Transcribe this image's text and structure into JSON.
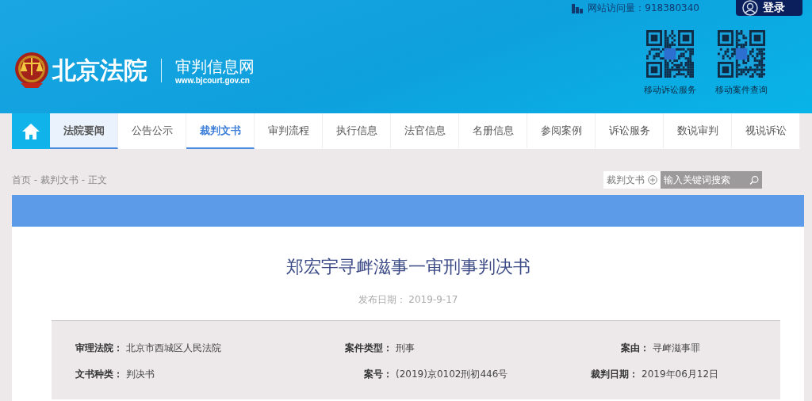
{
  "header": {
    "logo_title": "北京法院",
    "site_name": "审判信息网",
    "site_url": "www.bjcourt.gov.cn",
    "visits_label": "网站访问量：918380340",
    "login": "登录",
    "qr_codes": [
      {
        "caption": "移动诉讼服务"
      },
      {
        "caption": "移动案件查询"
      }
    ]
  },
  "nav": {
    "items": [
      {
        "label": "法院要闻",
        "selected": false,
        "highlighted": true
      },
      {
        "label": "公告公示",
        "selected": false,
        "highlighted": false
      },
      {
        "label": "裁判文书",
        "selected": true,
        "highlighted": false
      },
      {
        "label": "审判流程",
        "selected": false,
        "highlighted": false
      },
      {
        "label": "执行信息",
        "selected": false,
        "highlighted": false
      },
      {
        "label": "法官信息",
        "selected": false,
        "highlighted": false
      },
      {
        "label": "名册信息",
        "selected": false,
        "highlighted": false
      },
      {
        "label": "参阅案例",
        "selected": false,
        "highlighted": false
      },
      {
        "label": "诉讼服务",
        "selected": false,
        "highlighted": false
      },
      {
        "label": "数说审判",
        "selected": false,
        "highlighted": false
      },
      {
        "label": "视说诉讼",
        "selected": false,
        "highlighted": false
      }
    ]
  },
  "breadcrumb": "首页 - 裁判文书 - 正文",
  "search": {
    "category": "裁判文书",
    "placeholder": "输入关键词搜索"
  },
  "document": {
    "title": "郑宏宇寻衅滋事一审刑事判决书",
    "published": "发布日期： 2019-9-17",
    "fields": [
      {
        "label": "审理法院：",
        "value": "北京市西城区人民法院"
      },
      {
        "label": "案件类型：",
        "value": "刑事"
      },
      {
        "label": "案由：",
        "value": "寻衅滋事罪"
      },
      {
        "label": "文书种类：",
        "value": "判决书"
      },
      {
        "label": "案号：",
        "value": "(2019)京0102刑初446号"
      },
      {
        "label": "裁判日期：",
        "value": "2019年06月12日"
      }
    ]
  }
}
